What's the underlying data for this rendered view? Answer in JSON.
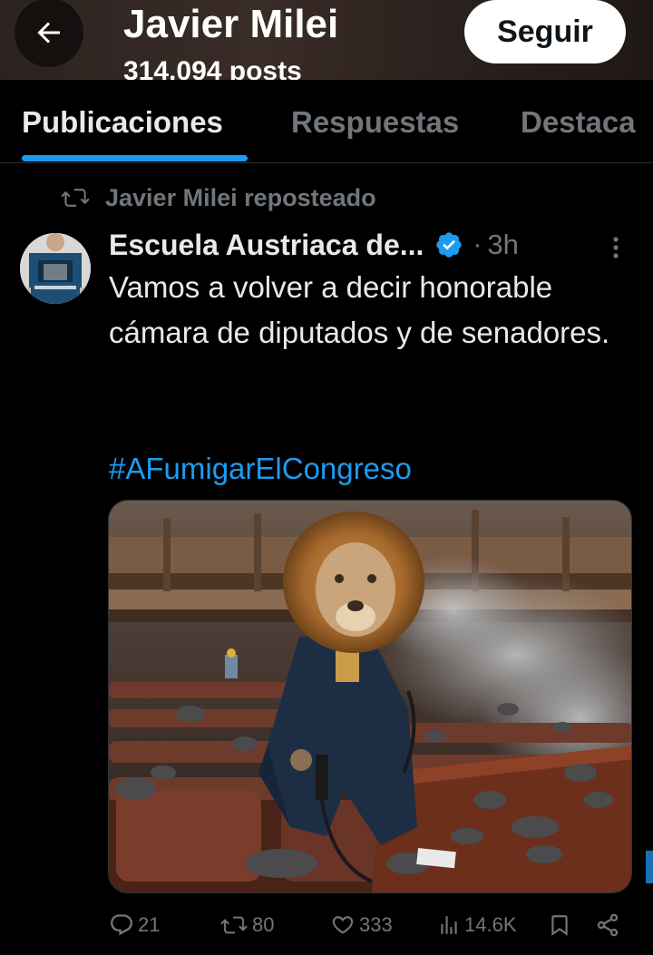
{
  "header": {
    "title": "Javier Milei",
    "subtitle": "314.094 posts",
    "follow_label": "Seguir",
    "back_icon": "arrow-left-icon"
  },
  "tabs": [
    {
      "label": "Publicaciones",
      "active": true
    },
    {
      "label": "Respuestas",
      "active": false
    },
    {
      "label": "Destaca",
      "active": false
    }
  ],
  "post": {
    "repost_label": "Javier Milei reposteado",
    "author_name": "Escuela Austriaca de...",
    "separator": "·",
    "time": "3h",
    "text": "Vamos a volver a decir honorable cámara de diputados y de senadores.",
    "hashtag": "#AFumigarElCongreso",
    "media_description_icon": "lion-in-congress-image",
    "stats": {
      "replies": "21",
      "reposts": "80",
      "likes": "333",
      "views": "14.6K"
    }
  },
  "colors": {
    "background": "#000000",
    "text": "#e7e9ea",
    "muted": "#71767b",
    "accent": "#1d9bf0"
  }
}
